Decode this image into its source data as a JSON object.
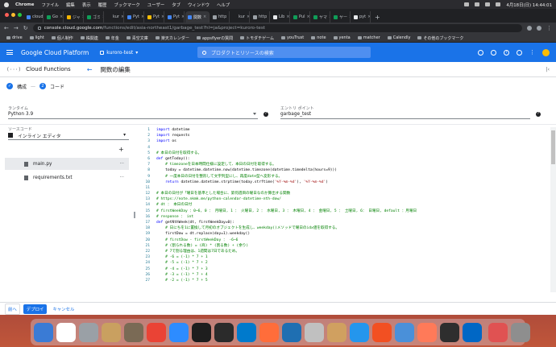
{
  "menubar": {
    "app": "Chrome",
    "items": [
      "ファイル",
      "編集",
      "表示",
      "履歴",
      "ブックマーク",
      "ユーザー",
      "タブ",
      "ウィンドウ",
      "ヘルプ"
    ],
    "clock": "4月18日(日)  14:44:01"
  },
  "tabs": [
    {
      "label": "cloud",
      "color": "#4285f4"
    },
    {
      "label": "Go",
      "color": "#0f9d58"
    },
    {
      "label": "ジャ",
      "color": "#f4b400"
    },
    {
      "label": "ゴミ",
      "color": "#0f9d58"
    },
    {
      "label": "kur",
      "color": "#202124"
    },
    {
      "label": "Pyt",
      "color": "#4285f4"
    },
    {
      "label": "Pyt",
      "color": "#fbbc04"
    },
    {
      "label": "Pyt",
      "color": "#4285f4"
    },
    {
      "label": "関数",
      "color": "#4285f4",
      "active": true
    },
    {
      "label": "http",
      "color": "#9aa0a6"
    },
    {
      "label": "kur",
      "color": "#202124"
    },
    {
      "label": "http",
      "color": "#9aa0a6"
    },
    {
      "label": "Lib",
      "color": "#e8eaed"
    },
    {
      "label": "Pul",
      "color": "#0f9d58"
    },
    {
      "label": "ヤマ",
      "color": "#0f9d58"
    },
    {
      "label": "ヤー",
      "color": "#0f9d58"
    },
    {
      "label": "pyt",
      "color": "#e8eaed"
    }
  ],
  "address": {
    "host": "console.cloud.google.com",
    "path": "/functions/edit/asia-northeast1/garbage_test?hl=ja&project=kuroro-test"
  },
  "bookmarks": [
    "drive",
    "light",
    "個人制作",
    "株関連",
    "年金",
    "青空文庫",
    "楽天カレンダー",
    "appsflyerの質問",
    "トモダチゲーム",
    "youTrust",
    "note",
    "yenta",
    "matcher",
    "Calendly",
    "その他のブックマーク"
  ],
  "gcp": {
    "brand": "Google Cloud Platform",
    "project": "kuroro-test",
    "search_placeholder": "プロダクトとリソースの検索",
    "product": "Cloud Functions",
    "page_title": "関数の編集",
    "steps": {
      "step1": "構成",
      "step2_num": "2",
      "step2": "コード"
    },
    "runtime_label": "ランタイム",
    "runtime_value": "Python 3.9",
    "entry_label": "エントリ ポイント",
    "entry_value": "garbage_test",
    "source_label": "ソースコード",
    "source_value": "インライン エディタ",
    "files": [
      "main.py",
      "requirements.txt"
    ],
    "actions": {
      "prev": "前へ",
      "deploy": "デプロイ",
      "cancel": "キャンセル"
    }
  },
  "code": [
    [
      {
        "t": "kw",
        "v": "import"
      },
      {
        "t": "tx",
        "v": " datetime"
      }
    ],
    [
      {
        "t": "kw",
        "v": "import"
      },
      {
        "t": "tx",
        "v": " requests"
      }
    ],
    [
      {
        "t": "kw",
        "v": "import"
      },
      {
        "t": "tx",
        "v": " os"
      }
    ],
    [],
    [
      {
        "t": "cm",
        "v": "# 本日の日付を取得する。"
      }
    ],
    [
      {
        "t": "kw",
        "v": "def"
      },
      {
        "t": "tx",
        "v": " getToday():"
      }
    ],
    [
      {
        "t": "cm",
        "v": "    # timezoneを日本時間仕様に設定して、本日の日付を取得する。"
      }
    ],
    [
      {
        "t": "tx",
        "v": "    today = datetime.datetime.now(datetime.timezone(datetime.timedelta(hours=9)))"
      }
    ],
    [
      {
        "t": "cm",
        "v": "    # 一度本日の日付を整形して文字列型にし、再度date型へ変形する。"
      }
    ],
    [
      {
        "t": "tx",
        "v": "    "
      },
      {
        "t": "kw",
        "v": "return"
      },
      {
        "t": "tx",
        "v": " datetime.datetime.strptime(today.strftime("
      },
      {
        "t": "st",
        "v": "'%Y-%m-%d'"
      },
      {
        "t": "tx",
        "v": "), "
      },
      {
        "t": "st",
        "v": "'%Y-%m-%d'"
      },
      {
        "t": "tx",
        "v": ")"
      }
    ],
    [],
    [
      {
        "t": "cm",
        "v": "# 本日の日付が「曜日を基準とした場合に、第何週目の曜日なのか算出する関数"
      }
    ],
    [
      {
        "t": "cm",
        "v": "# https://note.nkmk.me/python-calendar-datetime-nth-dow/"
      }
    ],
    [
      {
        "t": "cm",
        "v": "# dt ： 本日の日付"
      }
    ],
    [
      {
        "t": "cm",
        "v": "# firstWeekDay ：0~6, 0 ： 月曜日, 1 ： 火曜日, 2 ： 水曜日, 3 ： 木曜日, 4 ： 金曜日, 5 ： 土曜日, 6： 日曜日, default ：月曜日"
      }
    ],
    [
      {
        "t": "cm",
        "v": "# response ： int"
      }
    ],
    [
      {
        "t": "kw",
        "v": "def"
      },
      {
        "t": "tx",
        "v": " getNthWeek(dt, firstWeekDay=0):"
      }
    ],
    [
      {
        "t": "cm",
        "v": "    # 日にちを1に置換して月初のオブジェクトを生成し、weekday()メソッドで曜日のidx値を取得する。"
      }
    ],
    [
      {
        "t": "tx",
        "v": "    firstDow = dt.replace(day=1).weekday()"
      }
    ],
    [
      {
        "t": "cm",
        "v": "    # firstDow - firstWeekDay ： -6~6"
      }
    ],
    [
      {
        "t": "cm",
        "v": "    # (割られる数) = (商) * (割る数) + (余り)"
      }
    ],
    [
      {
        "t": "cm",
        "v": "    # 7で割る理由は、1週間は7日であるため。"
      }
    ],
    [
      {
        "t": "cm",
        "v": "    # -6 = (-1) * 7 + 1"
      }
    ],
    [
      {
        "t": "cm",
        "v": "    # -5 = (-1) * 7 + 2"
      }
    ],
    [
      {
        "t": "cm",
        "v": "    # -4 = (-1) * 7 + 3"
      }
    ],
    [
      {
        "t": "cm",
        "v": "    # -3 = (-1) * 7 + 4"
      }
    ],
    [
      {
        "t": "cm",
        "v": "    # -2 = (-1) * 7 + 5"
      }
    ]
  ],
  "dock": [
    "#3a7bd5",
    "#ffffff",
    "#9aa0a6",
    "#c9a060",
    "#7a6a55",
    "#ea4335",
    "#2d8cff",
    "#1e1e1e",
    "#2b2b2b",
    "#007acc",
    "#ff6d3a",
    "#1f6fb2",
    "#c0c0c0",
    "#d0a060",
    "#2496ed",
    "#f25022",
    "#4a90d9",
    "#ff7a59",
    "#2e2e2e",
    "#0067c5",
    "#e05252",
    "#8e8e8e"
  ]
}
